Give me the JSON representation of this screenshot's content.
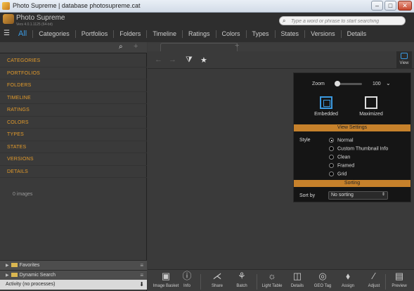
{
  "window": {
    "title": "Photo Supreme | database photosupreme.cat",
    "minimize": "–",
    "restore": "□",
    "close": "✕"
  },
  "app": {
    "name": "Photo Supreme",
    "version": "Vers 4.0.1.1125 (64-bit)"
  },
  "search": {
    "placeholder": "Type a word or phrase to start searching",
    "icon": "search-icon"
  },
  "nav": {
    "menu_icon": "☰",
    "items": [
      "All",
      "Categories",
      "Portfolios",
      "Folders",
      "Timeline",
      "Ratings",
      "Colors",
      "Types",
      "States",
      "Versions",
      "Details"
    ],
    "active": "All",
    "accent_color": "#3b9ae1"
  },
  "left": {
    "search_icon": "🔍",
    "plus": "+",
    "categories": [
      "CATEGORIES",
      "PORTFOLIOS",
      "FOLDERS",
      "TIMELINE",
      "RATINGS",
      "COLORS",
      "TYPES",
      "STATES",
      "VERSIONS",
      "DETAILS"
    ],
    "category_color": "#e39b2b",
    "image_count": "0 images",
    "favorites": "Favorites",
    "dynamic_search": "Dynamic Search",
    "activity": "Activity (no processes)",
    "menu_glyph": "≡",
    "tri": "▶"
  },
  "main": {
    "plus": "+",
    "back": "←",
    "forward": "→",
    "filter": "⧩",
    "star": "★",
    "view_label": "View"
  },
  "view_popup": {
    "zoom_label": "Zoom",
    "zoom_value": "100",
    "zoom_dropdown": "⌄",
    "modes": [
      "Embedded",
      "Maximized"
    ],
    "view_settings": "View Settings",
    "style_label": "Style",
    "styles": [
      "Normal",
      "Custom Thumbnail Info",
      "Clean",
      "Framed",
      "Grid"
    ],
    "selected_style": "Normal",
    "sorting": "Sorting",
    "sort_by_label": "Sort by",
    "sort_by_value": "No sorting",
    "sort_arrows": "⇕",
    "accent_color": "#c6812b"
  },
  "bottom_bar": {
    "items": [
      {
        "label": "Image Basket",
        "icon": "▣"
      },
      {
        "label": "Info",
        "icon": "ⓘ"
      },
      {
        "label": "Share",
        "icon": "⋌"
      },
      {
        "label": "Batch",
        "icon": "⚘"
      },
      {
        "label": "Light Table",
        "icon": "☼"
      },
      {
        "label": "Details",
        "icon": "◫"
      },
      {
        "label": "GEO Tag",
        "icon": "◎"
      },
      {
        "label": "Assign",
        "icon": "⬧"
      },
      {
        "label": "Adjust",
        "icon": "∕"
      },
      {
        "label": "Preview",
        "icon": "▤"
      }
    ]
  }
}
